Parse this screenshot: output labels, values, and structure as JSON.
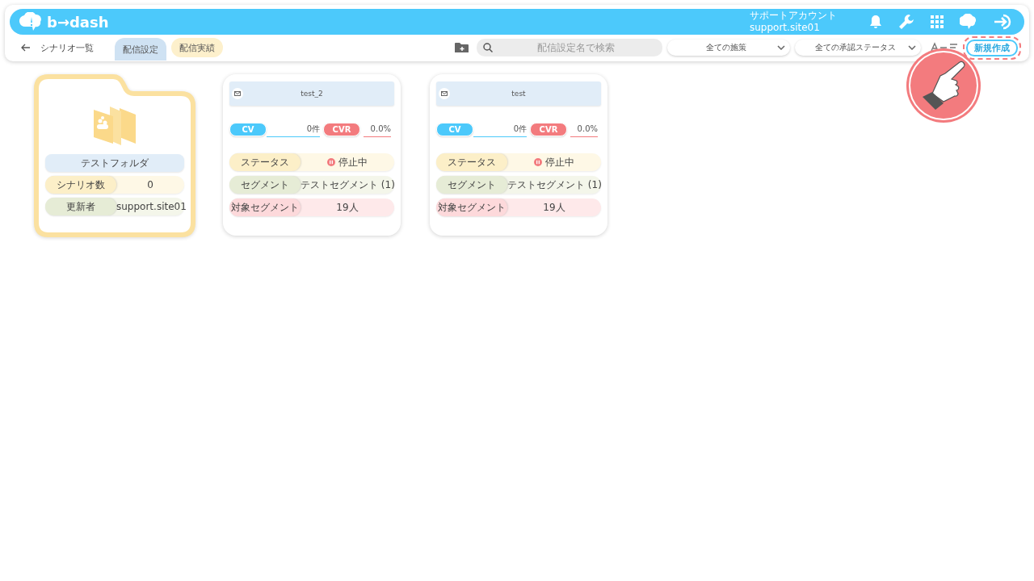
{
  "header": {
    "logo": "b→dash",
    "account_name": "サポートアカウント",
    "account_id": "support.site01"
  },
  "toolbar": {
    "back_label": "シナリオ一覧",
    "tabs": [
      {
        "label": "配信設定",
        "selected": true
      },
      {
        "label": "配信実績",
        "selected": false
      }
    ],
    "search": {
      "placeholder": "配信設定名で検索"
    },
    "filters": [
      "全ての施策",
      "全ての承認ステータス"
    ],
    "new_button": "新規作成"
  },
  "folders": [
    {
      "name": "テストフォルダ",
      "rows": [
        {
          "kind": "count",
          "label": "シナリオ数",
          "value": "0"
        },
        {
          "kind": "updater",
          "label": "更新者",
          "value": "support.site01"
        }
      ]
    }
  ],
  "scenarios": [
    {
      "name": "test_2",
      "cv_label": "CV",
      "cv_value": "0件",
      "cvr_label": "CVR",
      "cvr_value": "0.0%",
      "rows": [
        {
          "kind": "status",
          "label": "ステータス",
          "value": "停止中"
        },
        {
          "kind": "segment",
          "label": "セグメント",
          "value": "テストセグメント (1)"
        },
        {
          "kind": "target",
          "label": "対象セグメント",
          "value": "19人"
        }
      ]
    },
    {
      "name": "test",
      "cv_label": "CV",
      "cv_value": "0件",
      "cvr_label": "CVR",
      "cvr_value": "0.0%",
      "rows": [
        {
          "kind": "status",
          "label": "ステータス",
          "value": "停止中"
        },
        {
          "kind": "segment",
          "label": "セグメント",
          "value": "テストセグメント (1)"
        },
        {
          "kind": "target",
          "label": "対象セグメント",
          "value": "19人"
        }
      ]
    }
  ]
}
